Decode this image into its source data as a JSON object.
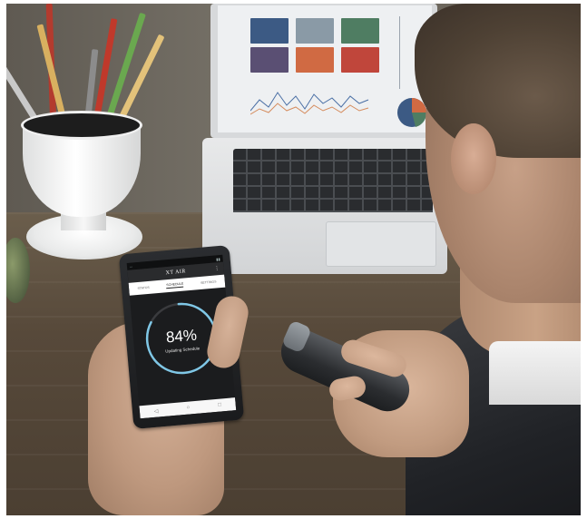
{
  "phone": {
    "app_title": "XT AIR",
    "tabs": [
      {
        "label": "STATUS",
        "active": false
      },
      {
        "label": "SCHEDULE",
        "active": true
      },
      {
        "label": "SETTINGS",
        "active": false
      }
    ],
    "gauge": {
      "percent_label": "84%",
      "progress": 0.84,
      "status_text": "Updating Schedule",
      "accent_color": "#7fc7e6"
    },
    "nav_icons": [
      "back-icon",
      "home-icon",
      "recents-icon"
    ]
  },
  "colors": {
    "screen_bg": "#1b1c1e",
    "laptop_tile_blue": "#3c5a84",
    "laptop_tile_orange": "#d06a43",
    "laptop_tile_red": "#c0463b",
    "laptop_tile_green": "#4f7d62"
  }
}
